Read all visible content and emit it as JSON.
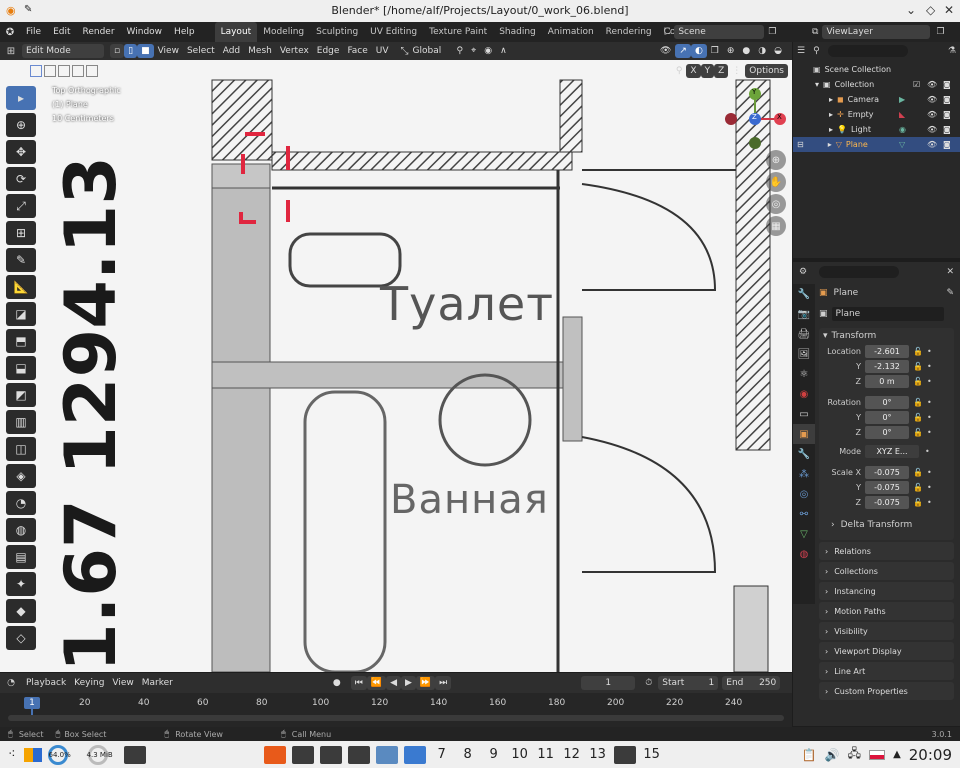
{
  "titlebar": {
    "title": "Blender* [/home/alf/Projects/Layout/0_work_06.blend]"
  },
  "menu": {
    "items": [
      "File",
      "Edit",
      "Render",
      "Window",
      "Help"
    ]
  },
  "workspaces": [
    "Layout",
    "Modeling",
    "Sculpting",
    "UV Editing",
    "Texture Paint",
    "Shading",
    "Animation",
    "Rendering",
    "Compositing"
  ],
  "scene": {
    "name": "Scene",
    "view_layer": "ViewLayer"
  },
  "vp_header": {
    "mode": "Edit Mode",
    "view": "View",
    "select": "Select",
    "add": "Add",
    "mesh": "Mesh",
    "vertex": "Vertex",
    "edge": "Edge",
    "face": "Face",
    "uv": "UV",
    "transform": "Global"
  },
  "vp_header2": {
    "x": "X",
    "y": "Y",
    "z": "Z",
    "options": "Options"
  },
  "viewport": {
    "line1": "Top Orthographic",
    "line2": "(1) Plane",
    "line3": "10 Centimeters",
    "room1": "Туалет",
    "room2": "Ванная",
    "dim": "1.67 1294.13"
  },
  "gizmo": {
    "x": "X",
    "y": "Y",
    "z": "Z"
  },
  "outliner": {
    "root": "Scene Collection",
    "collection": "Collection",
    "items": [
      "Camera",
      "Empty",
      "Light",
      "Plane"
    ]
  },
  "props": {
    "object_name": "Plane",
    "data_name": "Plane",
    "transform_label": "Transform",
    "location_label": "Location",
    "rotation_label": "Rotation",
    "mode_label": "Mode",
    "scale_label": "Scale X",
    "y": "Y",
    "z": "Z",
    "loc": [
      "-2.601",
      "-2.132",
      "0 m"
    ],
    "rot": [
      "0°",
      "0°",
      "0°"
    ],
    "mode": "XYZ E...",
    "scale": [
      "-0.075",
      "-0.075",
      "-0.075"
    ],
    "delta": "Delta Transform",
    "panels": [
      "Relations",
      "Collections",
      "Instancing",
      "Motion Paths",
      "Visibility",
      "Viewport Display",
      "Line Art",
      "Custom Properties"
    ]
  },
  "timeline": {
    "playback": "Playback",
    "keying": "Keying",
    "view": "View",
    "marker": "Marker",
    "current": "1",
    "start_label": "Start",
    "start": "1",
    "end_label": "End",
    "end": "250",
    "ticks": [
      "1",
      "20",
      "40",
      "60",
      "80",
      "100",
      "120",
      "140",
      "160",
      "180",
      "200",
      "220",
      "240"
    ]
  },
  "status": {
    "select": "Select",
    "box": "Box Select",
    "rotate": "Rotate View",
    "menu": "Call Menu",
    "version": "3.0.1"
  },
  "taskbar": {
    "cpu": "64.0%",
    "mem": "4.3 MiB",
    "desktops": [
      "7",
      "8",
      "9",
      "10",
      "11",
      "12",
      "13",
      "15"
    ],
    "time": "20:09"
  }
}
